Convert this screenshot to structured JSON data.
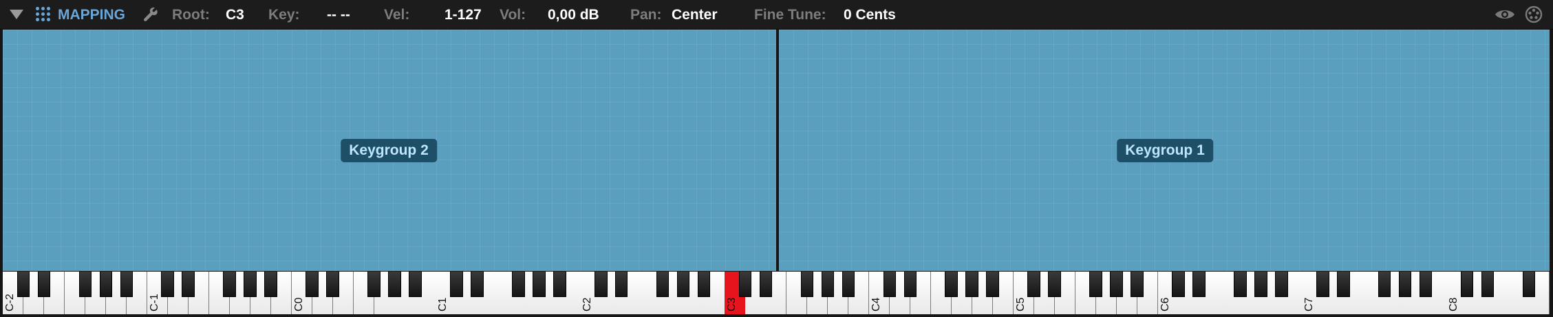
{
  "toolbar": {
    "title": "MAPPING",
    "root_label": "Root:",
    "root_value": "C3",
    "key_label": "Key:",
    "key_value": "-- --",
    "vel_label": "Vel:",
    "vel_value": "1-127",
    "vol_label": "Vol:",
    "vol_value": "0,00 dB",
    "pan_label": "Pan:",
    "pan_value": "Center",
    "fine_tune_label": "Fine Tune:",
    "fine_tune_value": "0 Cents",
    "icons": [
      "collapse-triangle-icon",
      "grid-menu-icon",
      "wrench-icon",
      "eye-icon",
      "palette-icon"
    ]
  },
  "zones": [
    {
      "label": "Keygroup 2",
      "color": "#5b9fbf"
    },
    {
      "label": "Keygroup 1",
      "color": "#5b9fbf"
    }
  ],
  "keyboard": {
    "octave_labels": [
      "C-2",
      "C-1",
      "C0",
      "C1",
      "C2",
      "C3",
      "C4",
      "C5",
      "C6",
      "C7",
      "C8"
    ],
    "pressed_note": "C3",
    "pressed_color": "#e8141d"
  }
}
